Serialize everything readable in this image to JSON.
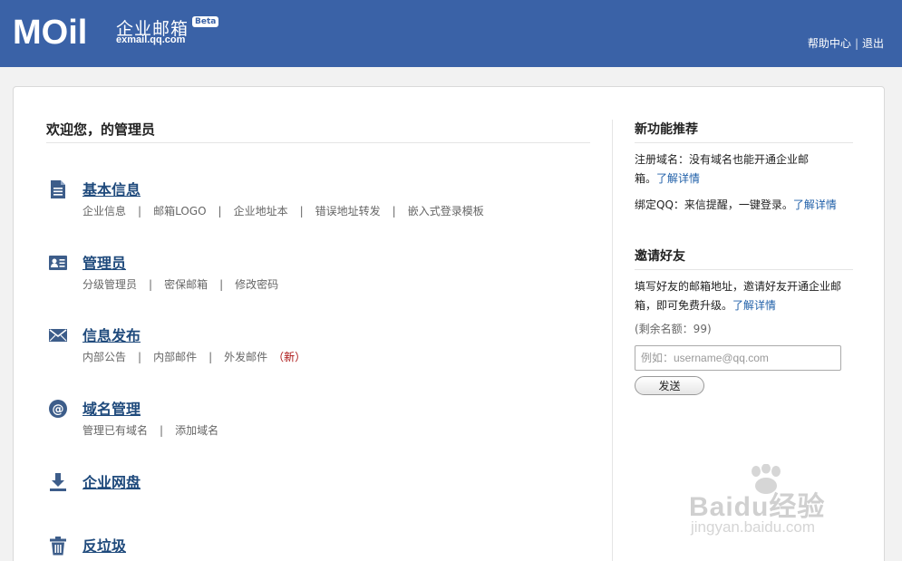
{
  "header": {
    "logo_text": "MOil",
    "brand_name": "企业邮箱",
    "beta_badge": "Beta",
    "brand_domain": "exmail.qq.com",
    "help_link": "帮助中心",
    "separator": "|",
    "logout_link": "退出"
  },
  "main": {
    "welcome": "欢迎您，的管理员",
    "sections": [
      {
        "title": "基本信息",
        "icon": "document-icon",
        "links": [
          "企业信息",
          "邮箱LOGO",
          "企业地址本",
          "错误地址转发",
          "嵌入式登录模板"
        ]
      },
      {
        "title": "管理员",
        "icon": "id-card-icon",
        "links": [
          "分级管理员",
          "密保邮箱",
          "修改密码"
        ]
      },
      {
        "title": "信息发布",
        "icon": "envelope-icon",
        "links": [
          "内部公告",
          "内部邮件",
          "外发邮件"
        ],
        "new_badge": "（新）"
      },
      {
        "title": "域名管理",
        "icon": "at-icon",
        "links": [
          "管理已有域名",
          "添加域名"
        ]
      },
      {
        "title": "企业网盘",
        "icon": "download-icon",
        "links": []
      },
      {
        "title": "反垃圾",
        "icon": "trash-icon",
        "links": []
      }
    ],
    "pipe": "|"
  },
  "sidebar": {
    "features_title": "新功能推荐",
    "feature1_text": "注册域名：没有域名也能开通企业邮箱。",
    "feature1_link": "了解详情",
    "feature2_text": "绑定QQ：来信提醒，一键登录。",
    "feature2_link": "了解详情",
    "invite_title": "邀请好友",
    "invite_text": "填写好友的邮箱地址，邀请好友开通企业邮箱，即可免费升级。",
    "invite_link": "了解详情",
    "quota": "(剩余名额：99)",
    "input_placeholder": "例如：username@qq.com",
    "send_button": "发送"
  },
  "watermark": {
    "text": "Baidu经验",
    "url": "jingyan.baidu.com"
  },
  "colors": {
    "header_bg": "#3a62a7",
    "title_blue": "#1f4a7c",
    "link_blue": "#1f5fa8",
    "new_red": "#aa1111"
  }
}
